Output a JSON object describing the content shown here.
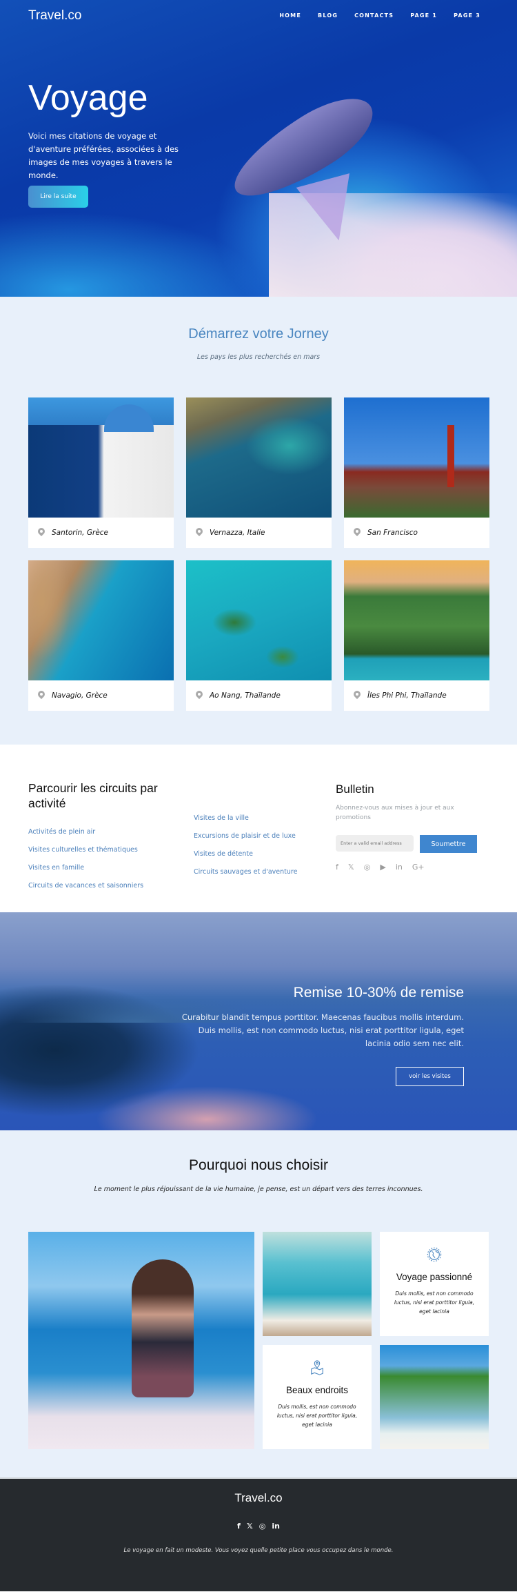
{
  "header": {
    "logo": "Travel.co",
    "nav": [
      {
        "label": "HOME"
      },
      {
        "label": "BLOG"
      },
      {
        "label": "CONTACTS"
      },
      {
        "label": "PAGE 1"
      },
      {
        "label": "PAGE 3"
      }
    ]
  },
  "hero": {
    "title": "Voyage",
    "text": "Voici mes citations de voyage et d'aventure préférées, associées à des images de mes voyages à travers le monde.",
    "button": "Lire la suite"
  },
  "destinations": {
    "title": "Démarrez votre Jorney",
    "subtitle": "Les pays les plus recherchés en mars",
    "items": [
      {
        "label": "Santorin, Grèce"
      },
      {
        "label": "Vernazza, Italie"
      },
      {
        "label": "San Francisco"
      },
      {
        "label": "Navagio, Grèce"
      },
      {
        "label": "Ao Nang, Thaïlande"
      },
      {
        "label": "Îles Phi Phi, Thaïlande"
      }
    ]
  },
  "tours": {
    "title": "Parcourir les circuits par activité",
    "col1": [
      {
        "label": "Activités de plein air"
      },
      {
        "label": "Visites culturelles et thématiques"
      },
      {
        "label": "Visites en famille"
      },
      {
        "label": "Circuits de vacances et saisonniers"
      }
    ],
    "col2": [
      {
        "label": "Visites de la ville"
      },
      {
        "label": "Excursions de plaisir et de luxe"
      },
      {
        "label": "Visites de détente"
      },
      {
        "label": "Circuits sauvages et d'aventure"
      }
    ]
  },
  "bulletin": {
    "title": "Bulletin",
    "text": "Abonnez-vous aux mises à jour et aux promotions",
    "email_placeholder": "Enter a valid email address",
    "email_value": "",
    "submit": "Soumettre",
    "social": [
      {
        "icon": "facebook-icon",
        "glyph": "f"
      },
      {
        "icon": "twitter-icon",
        "glyph": "🐦"
      },
      {
        "icon": "instagram-icon",
        "glyph": "◎"
      },
      {
        "icon": "youtube-icon",
        "glyph": "▶"
      },
      {
        "icon": "linkedin-icon",
        "glyph": "in"
      },
      {
        "icon": "google-plus-icon",
        "glyph": "G+"
      }
    ]
  },
  "discount": {
    "title": "Remise 10-30% de remise",
    "text": "Curabitur blandit tempus porttitor. Maecenas faucibus mollis interdum. Duis mollis, est non commodo luctus, nisi erat porttitor ligula, eget lacinia odio sem nec elit.",
    "button": "voir les visites"
  },
  "why": {
    "title": "Pourquoi nous choisir",
    "quote": "Le moment le plus réjouissant de la vie humaine, je pense, est un départ vers des terres inconnues.",
    "features": [
      {
        "title": "Voyage passionné",
        "text": "Duis mollis, est non commodo luctus, nisi erat porttitor ligula, eget lacinia",
        "icon": "globe-icon"
      },
      {
        "title": "Beaux endroits",
        "text": "Duis mollis, est non commodo luctus, nisi erat porttitor ligula, eget lacinia",
        "icon": "map-pin-icon"
      }
    ]
  },
  "footer": {
    "logo": "Travel.co",
    "social": [
      {
        "icon": "facebook-icon",
        "glyph": "f"
      },
      {
        "icon": "twitter-icon",
        "glyph": "🐦"
      },
      {
        "icon": "instagram-icon",
        "glyph": "◎"
      },
      {
        "icon": "linkedin-icon",
        "glyph": "in"
      }
    ],
    "quote": "Le voyage en fait un modeste. Vous voyez quelle petite place vous occupez dans le monde."
  }
}
